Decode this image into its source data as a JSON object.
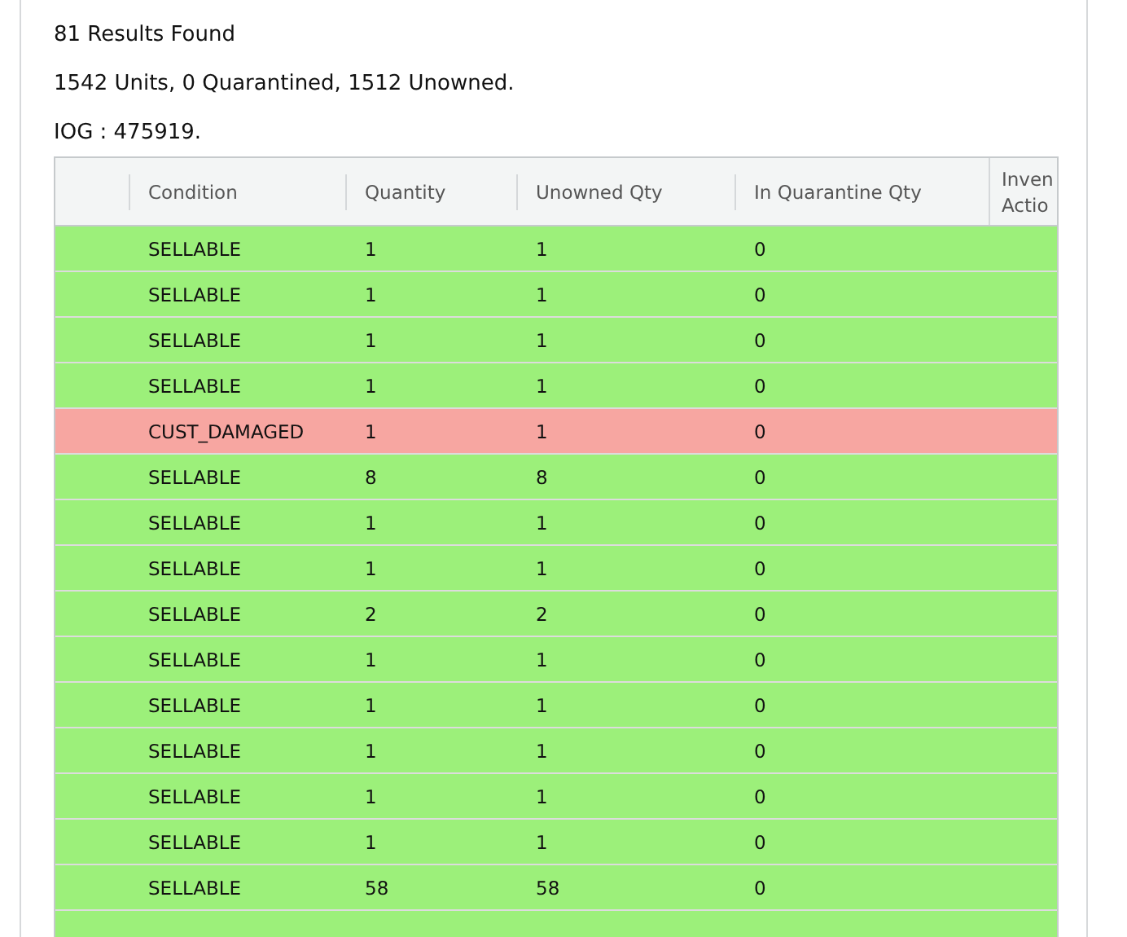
{
  "summary": [
    "81 Results Found",
    "1542 Units, 0 Quarantined, 1512 Unowned.",
    "IOG : 475919."
  ],
  "table": {
    "columns": [
      {},
      {
        "label": "Condition"
      },
      {
        "label": "Quantity"
      },
      {
        "label": "Unowned Qty"
      },
      {
        "label": "In Quarantine Qty"
      },
      {
        "lines": [
          "Inven",
          "Actio"
        ]
      }
    ],
    "rows": [
      {
        "color": "#9cf07a",
        "cells": [
          "",
          "SELLABLE",
          "1",
          "1",
          "0"
        ]
      },
      {
        "color": "#9cf07a",
        "cells": [
          "",
          "SELLABLE",
          "1",
          "1",
          "0"
        ]
      },
      {
        "color": "#9cf07a",
        "cells": [
          "",
          "SELLABLE",
          "1",
          "1",
          "0"
        ]
      },
      {
        "color": "#9cf07a",
        "cells": [
          "",
          "SELLABLE",
          "1",
          "1",
          "0"
        ]
      },
      {
        "color": "#f7a6a1",
        "cells": [
          "",
          "CUST_DAMAGED",
          "1",
          "1",
          "0"
        ]
      },
      {
        "color": "#9cf07a",
        "cells": [
          "",
          "SELLABLE",
          "8",
          "8",
          "0"
        ]
      },
      {
        "color": "#9cf07a",
        "cells": [
          "",
          "SELLABLE",
          "1",
          "1",
          "0"
        ]
      },
      {
        "color": "#9cf07a",
        "cells": [
          "",
          "SELLABLE",
          "1",
          "1",
          "0"
        ]
      },
      {
        "color": "#9cf07a",
        "cells": [
          "",
          "SELLABLE",
          "2",
          "2",
          "0"
        ]
      },
      {
        "color": "#9cf07a",
        "cells": [
          "",
          "SELLABLE",
          "1",
          "1",
          "0"
        ]
      },
      {
        "color": "#9cf07a",
        "cells": [
          "",
          "SELLABLE",
          "1",
          "1",
          "0"
        ]
      },
      {
        "color": "#9cf07a",
        "cells": [
          "",
          "SELLABLE",
          "1",
          "1",
          "0"
        ]
      },
      {
        "color": "#9cf07a",
        "cells": [
          "",
          "SELLABLE",
          "1",
          "1",
          "0"
        ]
      },
      {
        "color": "#9cf07a",
        "cells": [
          "",
          "SELLABLE",
          "1",
          "1",
          "0"
        ]
      },
      {
        "color": "#9cf07a",
        "cells": [
          "",
          "SELLABLE",
          "58",
          "58",
          "0"
        ]
      },
      {
        "color": "#9cf07a",
        "cells": []
      }
    ]
  }
}
